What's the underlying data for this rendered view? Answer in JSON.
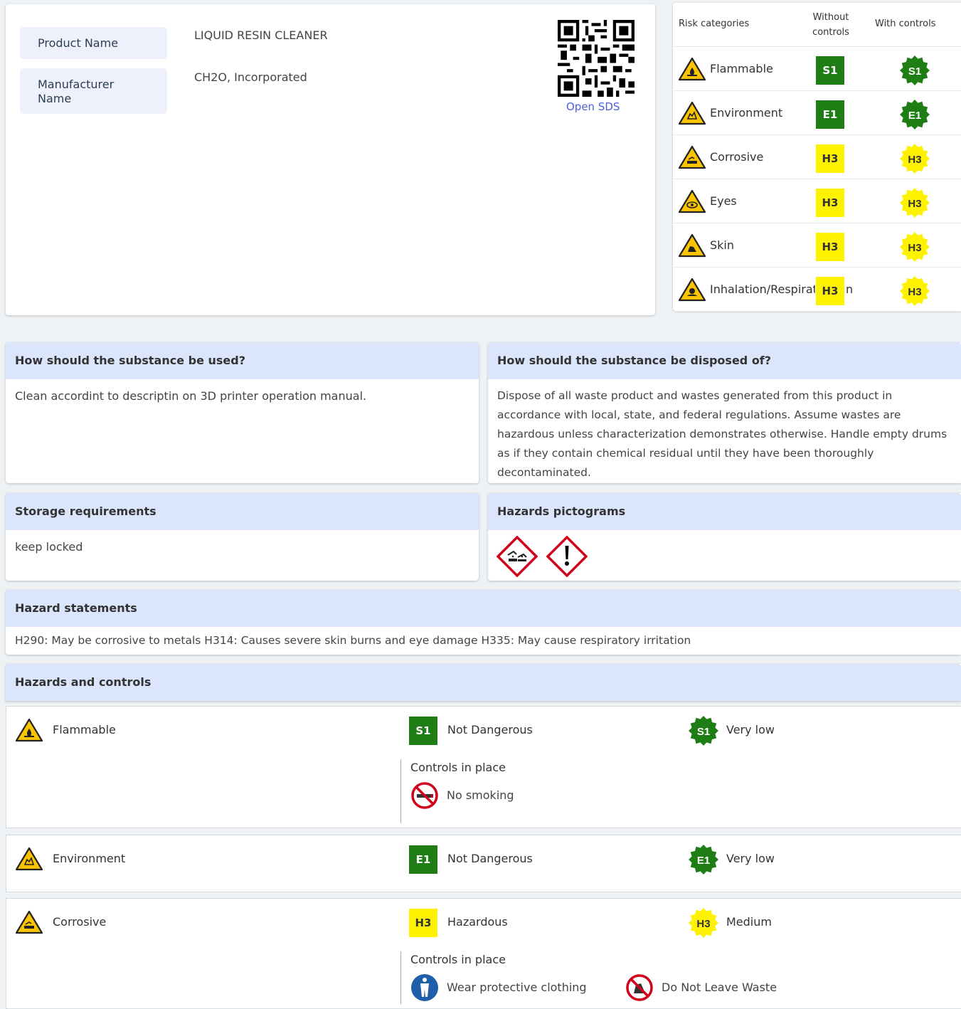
{
  "product": {
    "name_label": "Product Name",
    "name_value": "LIQUID RESIN CLEANER",
    "manufacturer_label": "Manufacturer Name",
    "manufacturer_value": "CH2O, Incorporated",
    "open_sds": "Open SDS"
  },
  "risk_table": {
    "headers": {
      "category": "Risk categories",
      "without": "Without controls",
      "with": "With controls"
    },
    "rows": [
      {
        "name": "Flammable",
        "icon": "flammable-warning-icon",
        "without": "S1",
        "with": "S1",
        "color": "#1e7e15"
      },
      {
        "name": "Environment",
        "icon": "environment-warning-icon",
        "without": "E1",
        "with": "E1",
        "color": "#1e7e15"
      },
      {
        "name": "Corrosive",
        "icon": "corrosive-warning-icon",
        "without": "H3",
        "with": "H3",
        "color": "#fff200"
      },
      {
        "name": "Eyes",
        "icon": "eyes-warning-icon",
        "without": "H3",
        "with": "H3",
        "color": "#fff200"
      },
      {
        "name": "Skin",
        "icon": "skin-warning-icon",
        "without": "H3",
        "with": "H3",
        "color": "#fff200"
      },
      {
        "name": "Inhalation/Respiration",
        "icon": "inhalation-warning-icon",
        "without": "H3",
        "with": "H3",
        "color": "#fff200"
      }
    ]
  },
  "usage": {
    "title": "How should the substance be used?",
    "body": "Clean accordint to descriptin on 3D printer operation manual."
  },
  "disposal": {
    "title": "How should the substance be disposed of?",
    "body": "Dispose of all waste product and wastes generated from this product in accordance with local, state, and federal regulations. Assume wastes are hazardous unless characterization demonstrates otherwise. Handle empty drums as if they contain chemical residual until they have been thoroughly decontaminated."
  },
  "storage": {
    "title": "Storage requirements",
    "body": "keep locked"
  },
  "pictograms": {
    "title": "Hazards pictograms",
    "items": [
      "corrosion-pictogram",
      "exclamation-pictogram"
    ]
  },
  "statements": {
    "title": "Hazard statements",
    "body": "H290: May be corrosive to metals H314: Causes severe skin burns and eye damage H335: May cause respiratory irritation"
  },
  "hazards_controls": {
    "title": "Hazards and controls",
    "controls_title": "Controls in place",
    "rows": [
      {
        "name": "Flammable",
        "without": "S1",
        "without_level": "Not Dangerous",
        "with": "S1",
        "with_level": "Very low",
        "controls": [
          "No smoking"
        ]
      },
      {
        "name": "Environment",
        "without": "E1",
        "without_level": "Not Dangerous",
        "with": "E1",
        "with_level": "Very low",
        "controls": []
      },
      {
        "name": "Corrosive",
        "without": "H3",
        "without_level": "Hazardous",
        "with": "H3",
        "with_level": "Medium",
        "controls": [
          "Wear protective clothing",
          "Do Not Leave Waste"
        ]
      }
    ]
  },
  "colors": {
    "green": "#1e7e15",
    "yellow": "#fff200",
    "header_blue": "#dbe5fb",
    "link": "#4b5fd6"
  }
}
